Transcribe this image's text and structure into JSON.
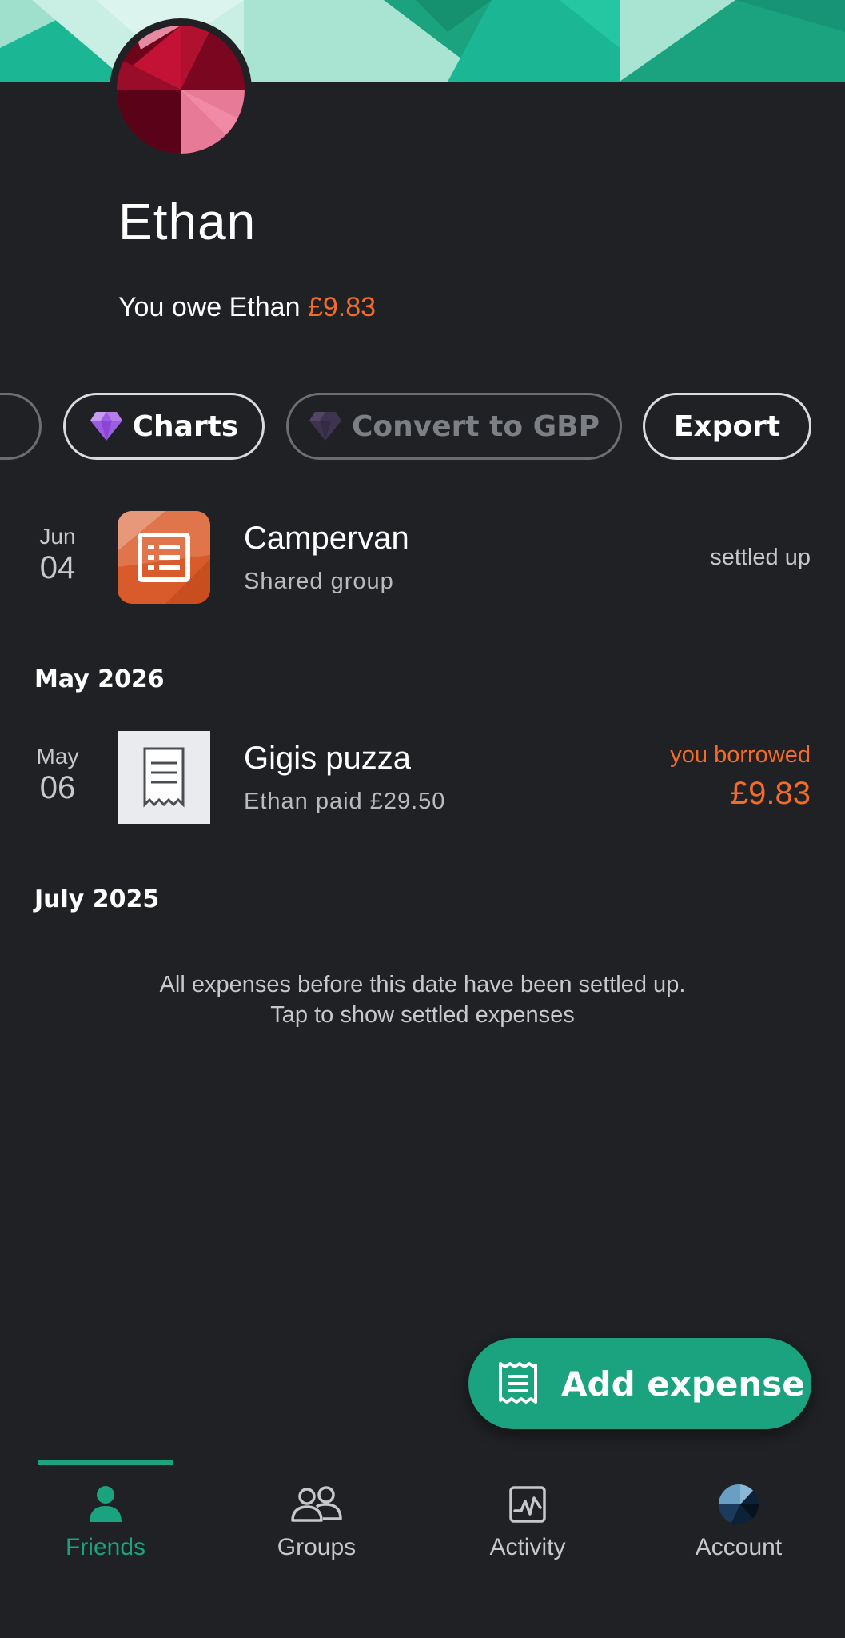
{
  "profile": {
    "name": "Ethan",
    "balance_prefix": "You owe Ethan ",
    "balance_amount": "£9.83"
  },
  "actions": {
    "charts_label": "Charts",
    "convert_label": "Convert to GBP",
    "export_label": "Export"
  },
  "expenses": [
    {
      "month": "Jun",
      "day": "04",
      "title": "Campervan",
      "subtitle": "Shared group",
      "status": "settled up",
      "icon": "group-list-icon"
    },
    {
      "section": "May 2026",
      "month": "May",
      "day": "06",
      "title": "Gigis puzza",
      "subtitle": "Ethan paid £29.50",
      "status": "you borrowed",
      "amount": "£9.83",
      "icon": "receipt-icon"
    }
  ],
  "sections": {
    "second": "July 2025"
  },
  "settled_note": {
    "line1": "All expenses before this date have been settled up.",
    "line2": "Tap to show settled expenses"
  },
  "fab": {
    "label": "Add expense",
    "icon": "receipt-icon"
  },
  "nav": {
    "active": "Friends",
    "items": [
      {
        "label": "Friends",
        "icon": "person-icon"
      },
      {
        "label": "Groups",
        "icon": "people-icon"
      },
      {
        "label": "Activity",
        "icon": "activity-chart-icon"
      },
      {
        "label": "Account",
        "icon": "account-avatar-icon"
      }
    ]
  },
  "colors": {
    "background": "#1f2124",
    "accent": "#1aa37e",
    "owe": "#f26b2a",
    "muted": "#c6c8cb"
  }
}
